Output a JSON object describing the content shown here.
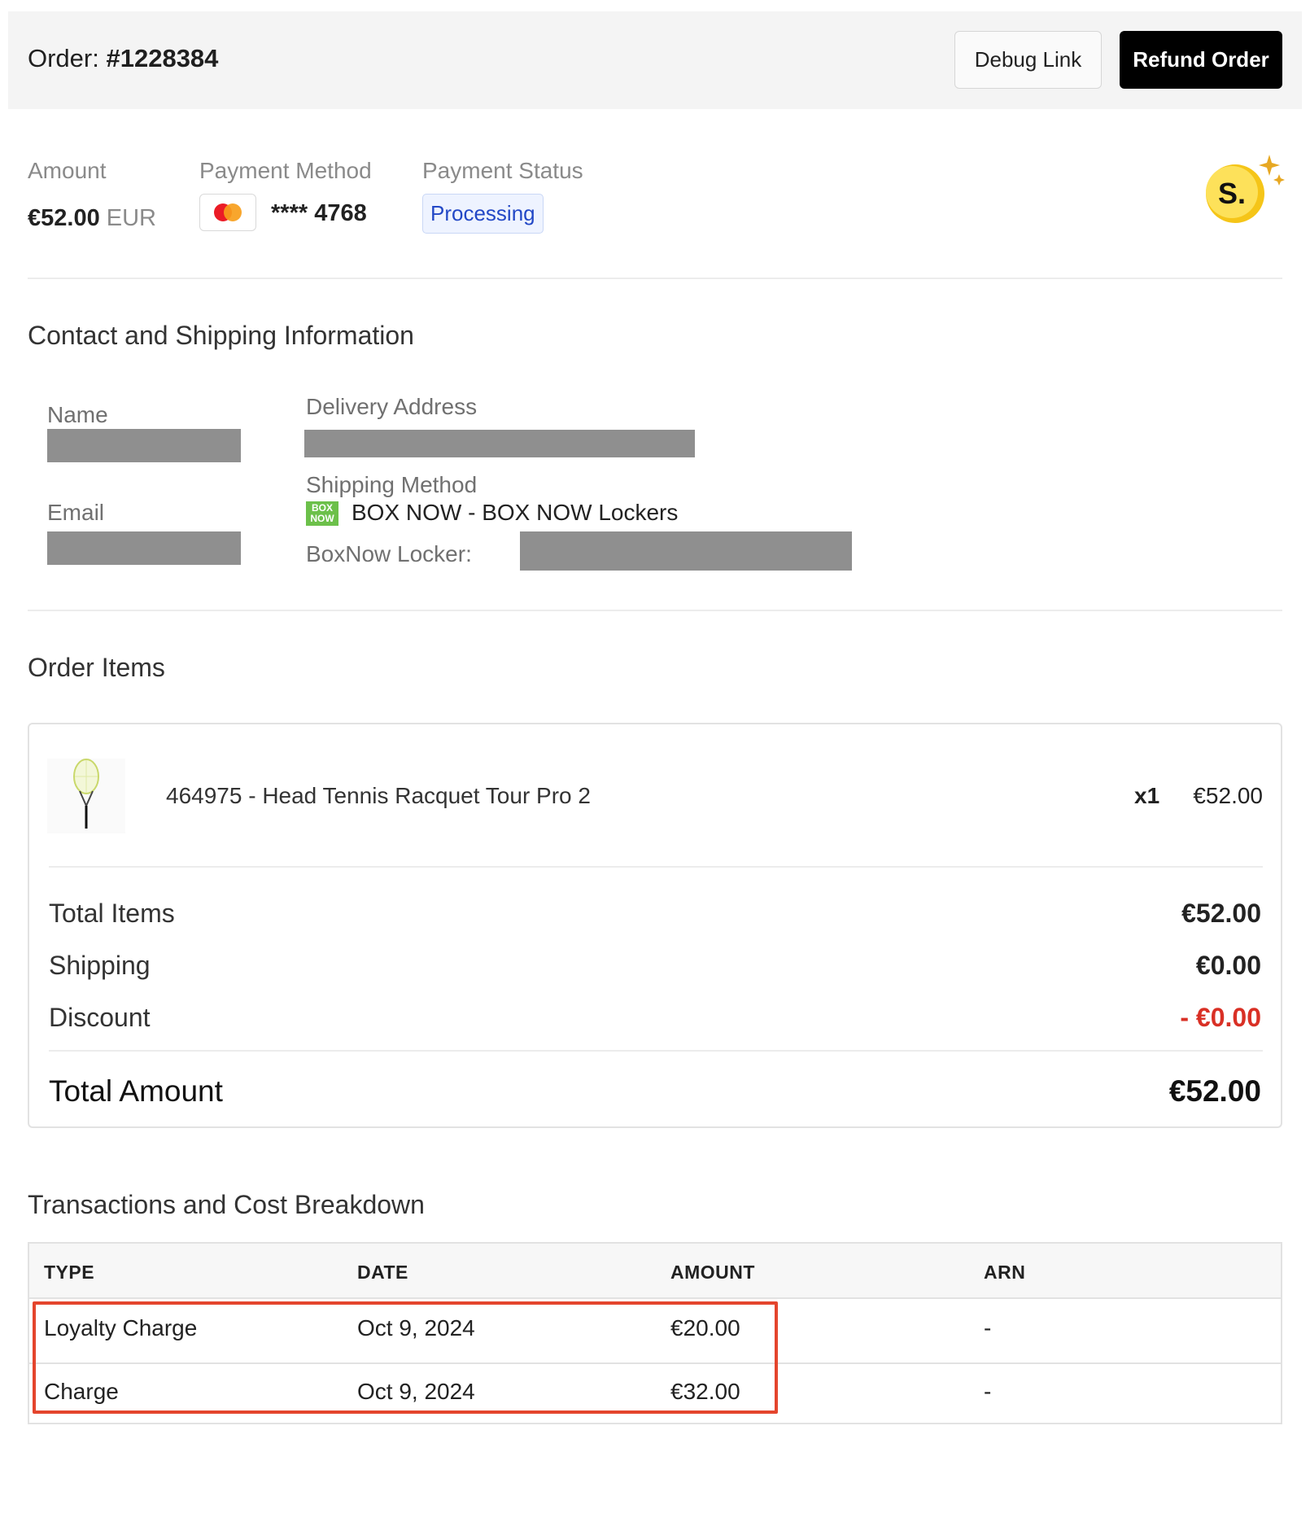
{
  "header": {
    "order_prefix": "Order:",
    "order_number": "#1228384",
    "debug_link_label": "Debug Link",
    "refund_order_label": "Refund Order"
  },
  "summary": {
    "amount_label": "Amount",
    "amount_value": "€52.00",
    "amount_currency": "EUR",
    "payment_method_label": "Payment Method",
    "card_brand_icon": "mastercard-icon",
    "card_masked": "**** 4768",
    "payment_status_label": "Payment Status",
    "payment_status_value": "Processing",
    "brand_badge_letter": "S."
  },
  "contact": {
    "title": "Contact and Shipping Information",
    "name_label": "Name",
    "email_label": "Email",
    "delivery_address_label": "Delivery Address",
    "shipping_method_label": "Shipping Method",
    "shipping_logo_text_top": "BOX",
    "shipping_logo_text_bottom": "NOW",
    "shipping_method_value": "BOX NOW - BOX NOW Lockers",
    "locker_label": "BoxNow Locker:"
  },
  "order_items": {
    "title": "Order Items",
    "items": [
      {
        "name": "464975 - Head Tennis Racquet Tour Pro 2",
        "qty": "x1",
        "price": "€52.00"
      }
    ],
    "totals": {
      "total_items_label": "Total Items",
      "total_items_value": "€52.00",
      "shipping_label": "Shipping",
      "shipping_value": "€0.00",
      "discount_label": "Discount",
      "discount_value": "- €0.00",
      "total_amount_label": "Total Amount",
      "total_amount_value": "€52.00"
    }
  },
  "transactions": {
    "title": "Transactions and Cost Breakdown",
    "columns": [
      "TYPE",
      "DATE",
      "AMOUNT",
      "ARN"
    ],
    "rows": [
      {
        "type": "Loyalty Charge",
        "date": "Oct 9, 2024",
        "amount": "€20.00",
        "arn": "-"
      },
      {
        "type": "Charge",
        "date": "Oct 9, 2024",
        "amount": "€32.00",
        "arn": "-"
      }
    ]
  },
  "colors": {
    "accent_button": "#000000",
    "status_badge_text": "#2348c6",
    "discount": "#d93025",
    "highlight_box": "#e4452d",
    "boxnow_green": "#6cc04a"
  }
}
